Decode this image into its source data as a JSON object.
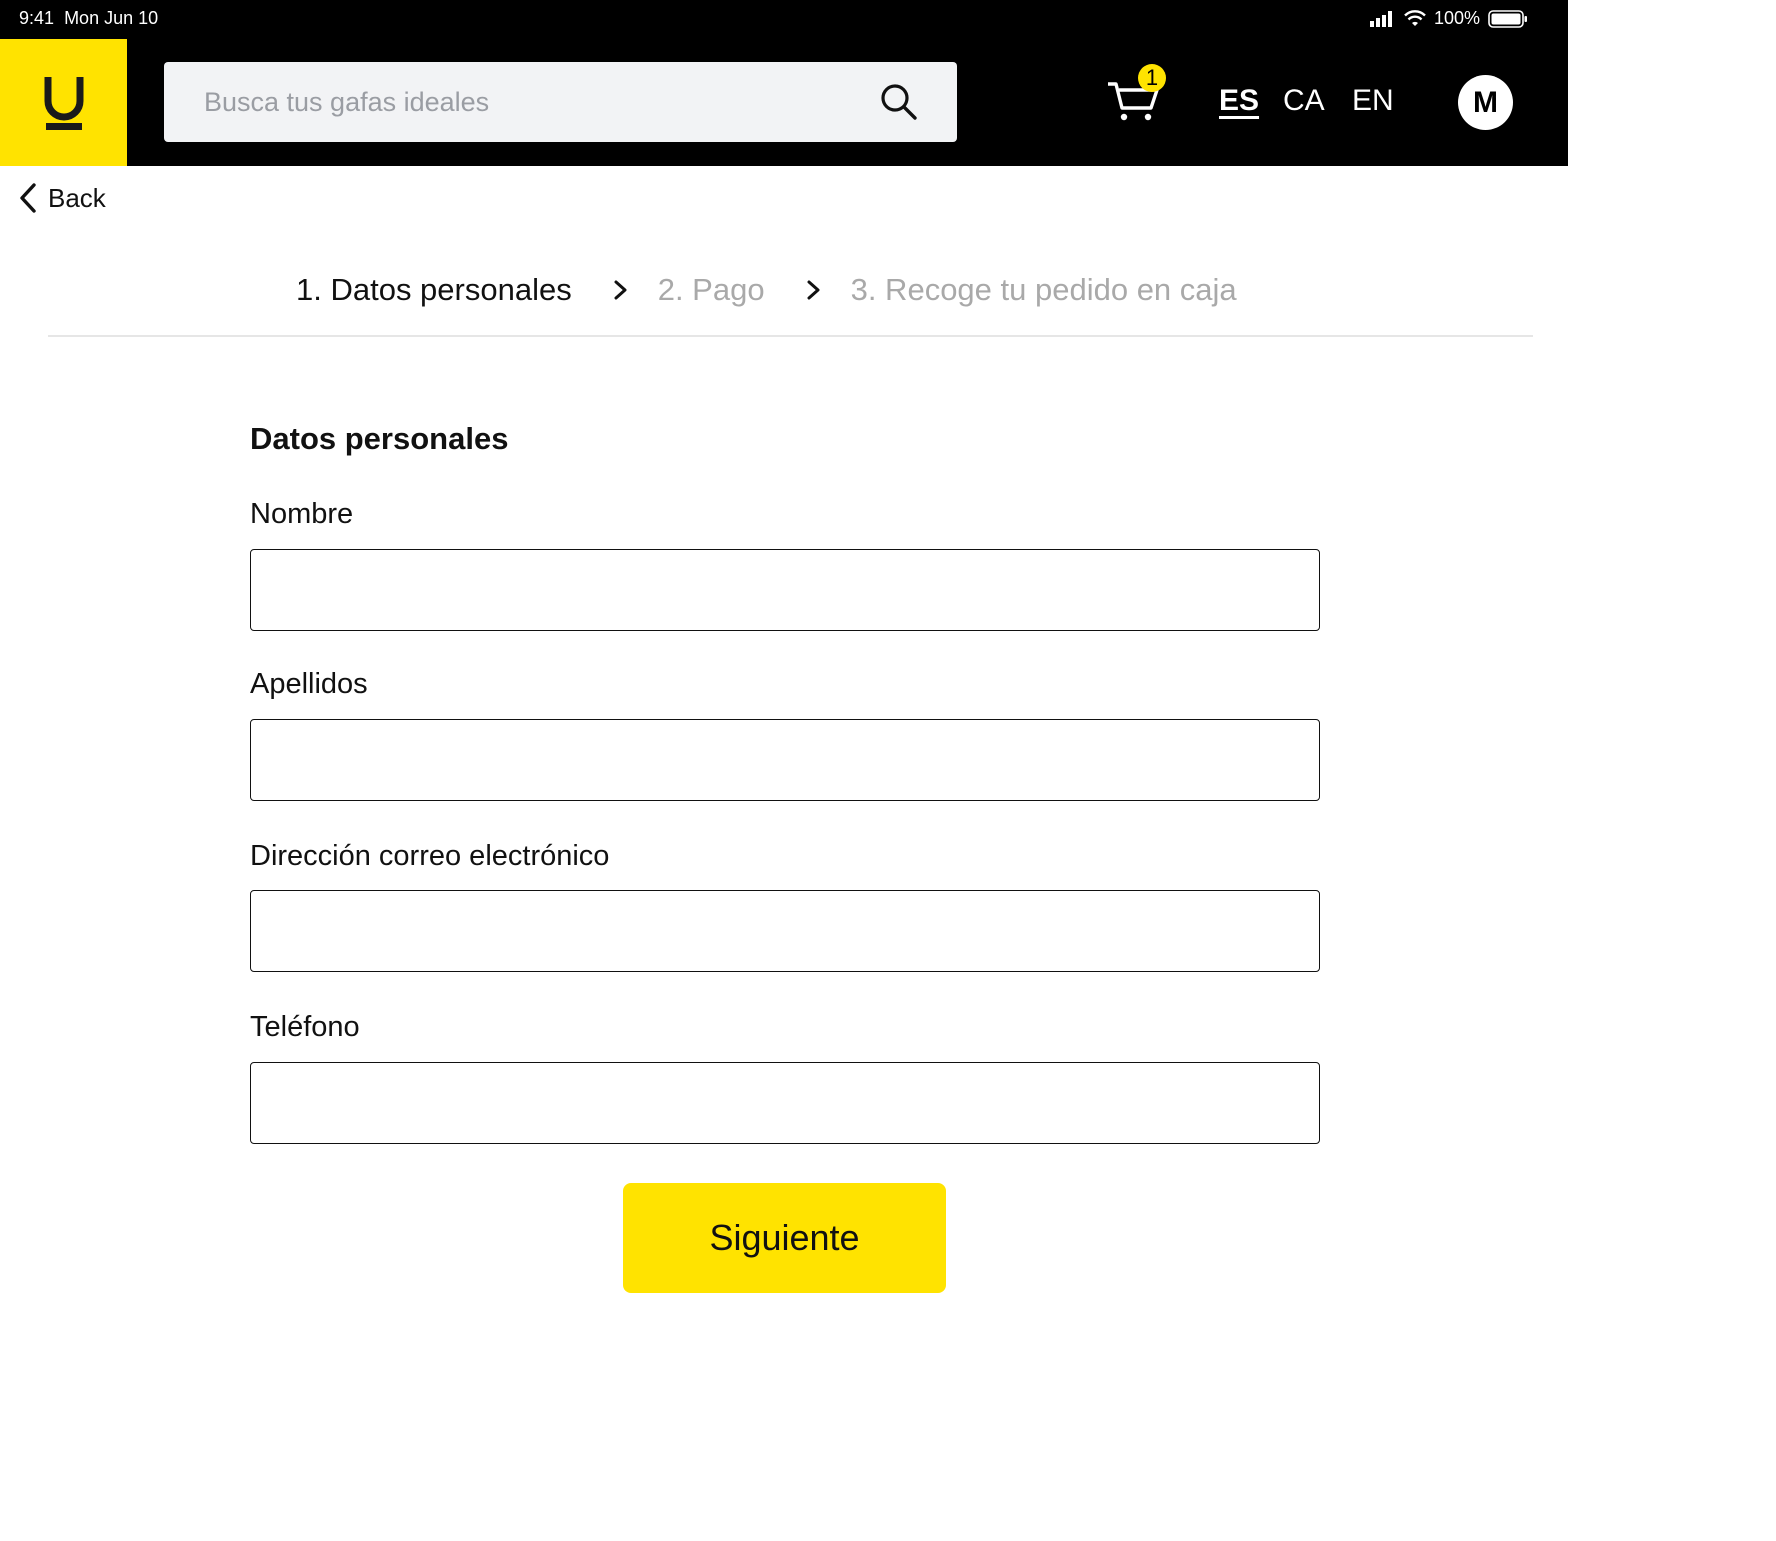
{
  "status_bar": {
    "time": "9:41",
    "date": "Mon Jun 10",
    "battery": "100%"
  },
  "header": {
    "logo_letter": "U",
    "search": {
      "placeholder": "Busca tus gafas ideales",
      "value": ""
    },
    "cart": {
      "count": "1"
    },
    "languages": [
      {
        "code": "ES",
        "active": true
      },
      {
        "code": "CA",
        "active": false
      },
      {
        "code": "EN",
        "active": false
      }
    ],
    "avatar_initial": "M"
  },
  "navigation": {
    "back_label": "Back"
  },
  "steps": [
    {
      "label": "1. Datos personales",
      "active": true
    },
    {
      "label": "2. Pago",
      "active": false
    },
    {
      "label": "3. Recoge tu pedido en caja",
      "active": false
    }
  ],
  "form": {
    "title": "Datos personales",
    "fields": [
      {
        "label": "Nombre",
        "value": ""
      },
      {
        "label": "Apellidos",
        "value": ""
      },
      {
        "label": "Dirección correo electrónico",
        "value": ""
      },
      {
        "label": "Teléfono",
        "value": ""
      }
    ],
    "submit_label": "Siguiente"
  },
  "colors": {
    "accent": "#FFE300",
    "header_bg": "#000000",
    "search_bg": "#F2F3F5",
    "inactive_step": "#A9A9A9"
  }
}
